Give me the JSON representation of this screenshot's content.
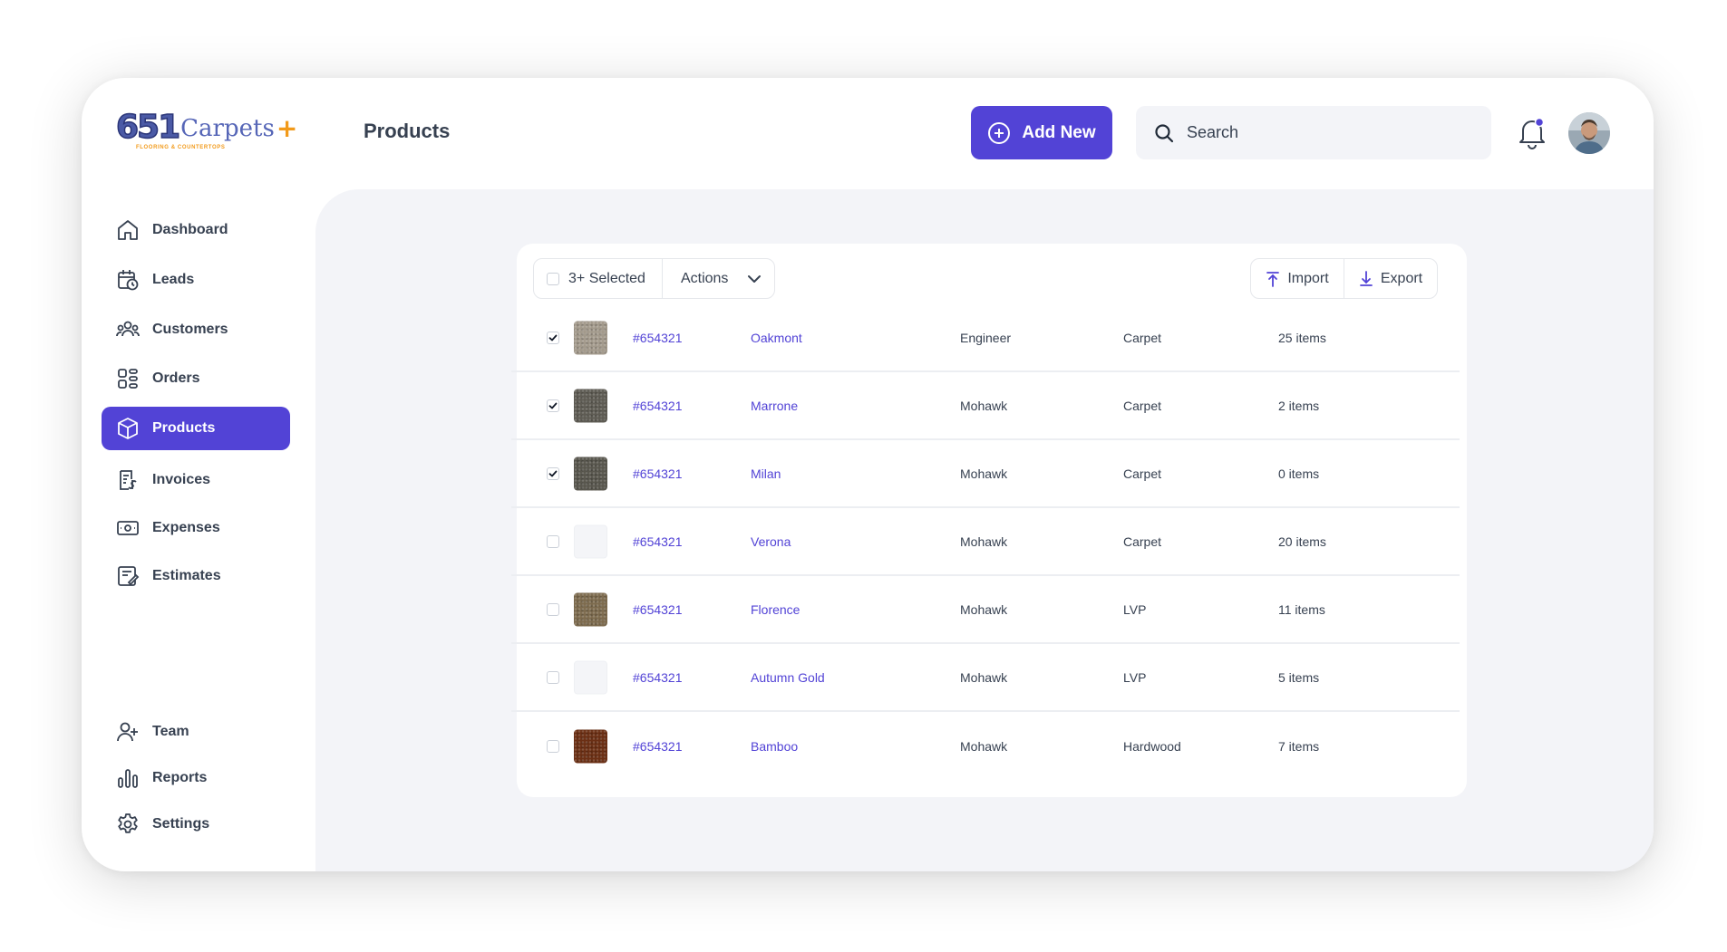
{
  "brand": {
    "logo_mark": "651",
    "logo_word": "Carpets",
    "logo_plus": "+",
    "logo_tagline": "FLOORING & COUNTERTOPS",
    "colors": {
      "primary": "#5243d6",
      "accent": "#f29a1a"
    }
  },
  "header": {
    "page_title": "Products",
    "add_new_label": "Add New",
    "search_placeholder": "Search",
    "has_notification": true
  },
  "sidebar": {
    "items": [
      {
        "label": "Dashboard",
        "icon": "home-icon",
        "active": false
      },
      {
        "label": "Leads",
        "icon": "calendar-clock-icon",
        "active": false
      },
      {
        "label": "Customers",
        "icon": "users-icon",
        "active": false
      },
      {
        "label": "Orders",
        "icon": "grid-icon",
        "active": false
      },
      {
        "label": "Products",
        "icon": "box-icon",
        "active": true
      },
      {
        "label": "Invoices",
        "icon": "invoice-icon",
        "active": false
      },
      {
        "label": "Expenses",
        "icon": "banknote-icon",
        "active": false
      },
      {
        "label": "Estimates",
        "icon": "estimate-icon",
        "active": false
      }
    ],
    "bottom_items": [
      {
        "label": "Team",
        "icon": "user-plus-icon"
      },
      {
        "label": "Reports",
        "icon": "bar-chart-icon"
      },
      {
        "label": "Settings",
        "icon": "gear-icon"
      }
    ]
  },
  "toolbar": {
    "selected_label": "3+ Selected",
    "actions_label": "Actions",
    "import_label": "Import",
    "export_label": "Export"
  },
  "products": [
    {
      "checked": true,
      "swatch": "#a39a8c",
      "id": "#654321",
      "name": "Oakmont",
      "brand": "Engineer",
      "type": "Carpet",
      "qty": "25 items"
    },
    {
      "checked": true,
      "swatch": "#5e5b53",
      "id": "#654321",
      "name": "Marrone",
      "brand": "Mohawk",
      "type": "Carpet",
      "qty": "2 items"
    },
    {
      "checked": true,
      "swatch": "#58564d",
      "id": "#654321",
      "name": "Milan",
      "brand": "Mohawk",
      "type": "Carpet",
      "qty": "0 items"
    },
    {
      "checked": false,
      "swatch": "",
      "id": "#654321",
      "name": "Verona",
      "brand": "Mohawk",
      "type": "Carpet",
      "qty": "20 items"
    },
    {
      "checked": false,
      "swatch": "#7d6b4e",
      "id": "#654321",
      "name": "Florence",
      "brand": "Mohawk",
      "type": "LVP",
      "qty": "11 items"
    },
    {
      "checked": false,
      "swatch": "",
      "id": "#654321",
      "name": "Autumn Gold",
      "brand": "Mohawk",
      "type": "LVP",
      "qty": "5 items"
    },
    {
      "checked": false,
      "swatch": "#6b2f14",
      "id": "#654321",
      "name": "Bamboo",
      "brand": "Mohawk",
      "type": "Hardwood",
      "qty": "7 items"
    }
  ]
}
